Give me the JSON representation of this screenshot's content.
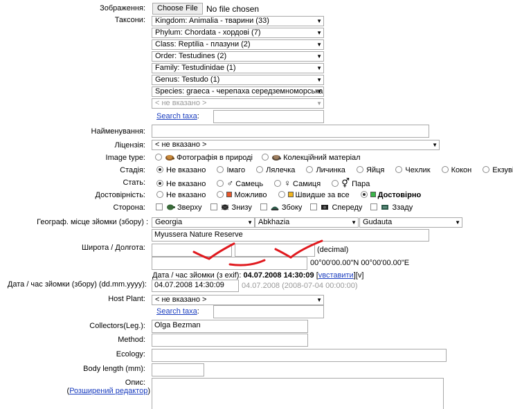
{
  "image": {
    "label": "Зображення:",
    "button": "Choose File",
    "status": "No file chosen"
  },
  "taxa": {
    "label": "Таксони:",
    "selects": [
      "Kingdom: Animalia - тварини (33)",
      "Phylum: Chordata - хордові (7)",
      "Class: Reptilia - плазуни (2)",
      "Order: Testudines (2)",
      "Family: Testudinidae (1)",
      "Genus: Testudo (1)",
      "Species: graeca - черепаха середземноморська",
      "< не вказано >"
    ],
    "search_link": "Search taxa",
    "search_suffix": ":",
    "search_value": ""
  },
  "name": {
    "label": "Найменування:",
    "value": ""
  },
  "license": {
    "label": "Ліцензія:",
    "value": "< не вказано >"
  },
  "image_type": {
    "label": "Image type:",
    "options": [
      "Фотографія в природі",
      "Колекційний матеріал"
    ],
    "selected": 0
  },
  "stage": {
    "label": "Стадія:",
    "options": [
      "Не вказано",
      "Імаго",
      "Лялечка",
      "Личинка",
      "Яйця",
      "Чехлик",
      "Кокон",
      "Екзувій"
    ],
    "selected": 0
  },
  "sex": {
    "label": "Стать:",
    "options": [
      "Не вказано",
      "Самець",
      "Самиця",
      "Пара"
    ],
    "symbols": [
      "",
      "♂",
      "♀",
      "⚥"
    ],
    "selected": 0
  },
  "reliability": {
    "label": "Достовірність:",
    "options": [
      "Не вказано",
      "Можливо",
      "Швидше за все",
      "Достовірно"
    ],
    "colors": [
      "",
      "#e8562a",
      "#f2b51f",
      "#3bb54a"
    ],
    "selected": 3
  },
  "side": {
    "label": "Сторона:",
    "options": [
      "Зверху",
      "Знизу",
      "Збоку",
      "Спереду",
      "Ззаду"
    ]
  },
  "location": {
    "label": "Географ. місце зйомки (збору) :",
    "country": "Georgia",
    "region": "Abkhazia",
    "district": "Gudauta",
    "place": "Myussera Nature Reserve"
  },
  "coords": {
    "label": "Широта / Долгота:",
    "lat": "",
    "lon": "",
    "unit": "(decimal)",
    "dms_value": "",
    "dms_text": "00°00'00.00\"N 00°00'00.00\"E",
    "annotation_color": "#e0191e"
  },
  "exif": {
    "prefix": "Дата / час зйомки (з exif):",
    "datetime": "04.07.2008 14:30:09",
    "bracket_open": "[",
    "v": "v",
    "insert": "вставити",
    "bracket_close": "][v]"
  },
  "date": {
    "label": "Дата / час зйомки (збору) (dd.mm.yyyy):",
    "value": "04.07.2008 14:30:09",
    "hint": "04.07.2008 (2008-07-04 00:00:00)"
  },
  "host_plant": {
    "label": "Host Plant:",
    "value": "< не вказано >",
    "search_link": "Search taxa",
    "search_suffix": ":",
    "search_value": ""
  },
  "collectors": {
    "label": "Collectors(Leg.):",
    "value": "Olga Bezman"
  },
  "method": {
    "label": "Method:",
    "value": ""
  },
  "ecology": {
    "label": "Ecology:",
    "value": ""
  },
  "body_length": {
    "label": "Body length (mm):",
    "value": ""
  },
  "description": {
    "label": "Опис:",
    "editor_link": "Розширений редактор",
    "paren_open": "(",
    "paren_close": ")",
    "value": ""
  }
}
